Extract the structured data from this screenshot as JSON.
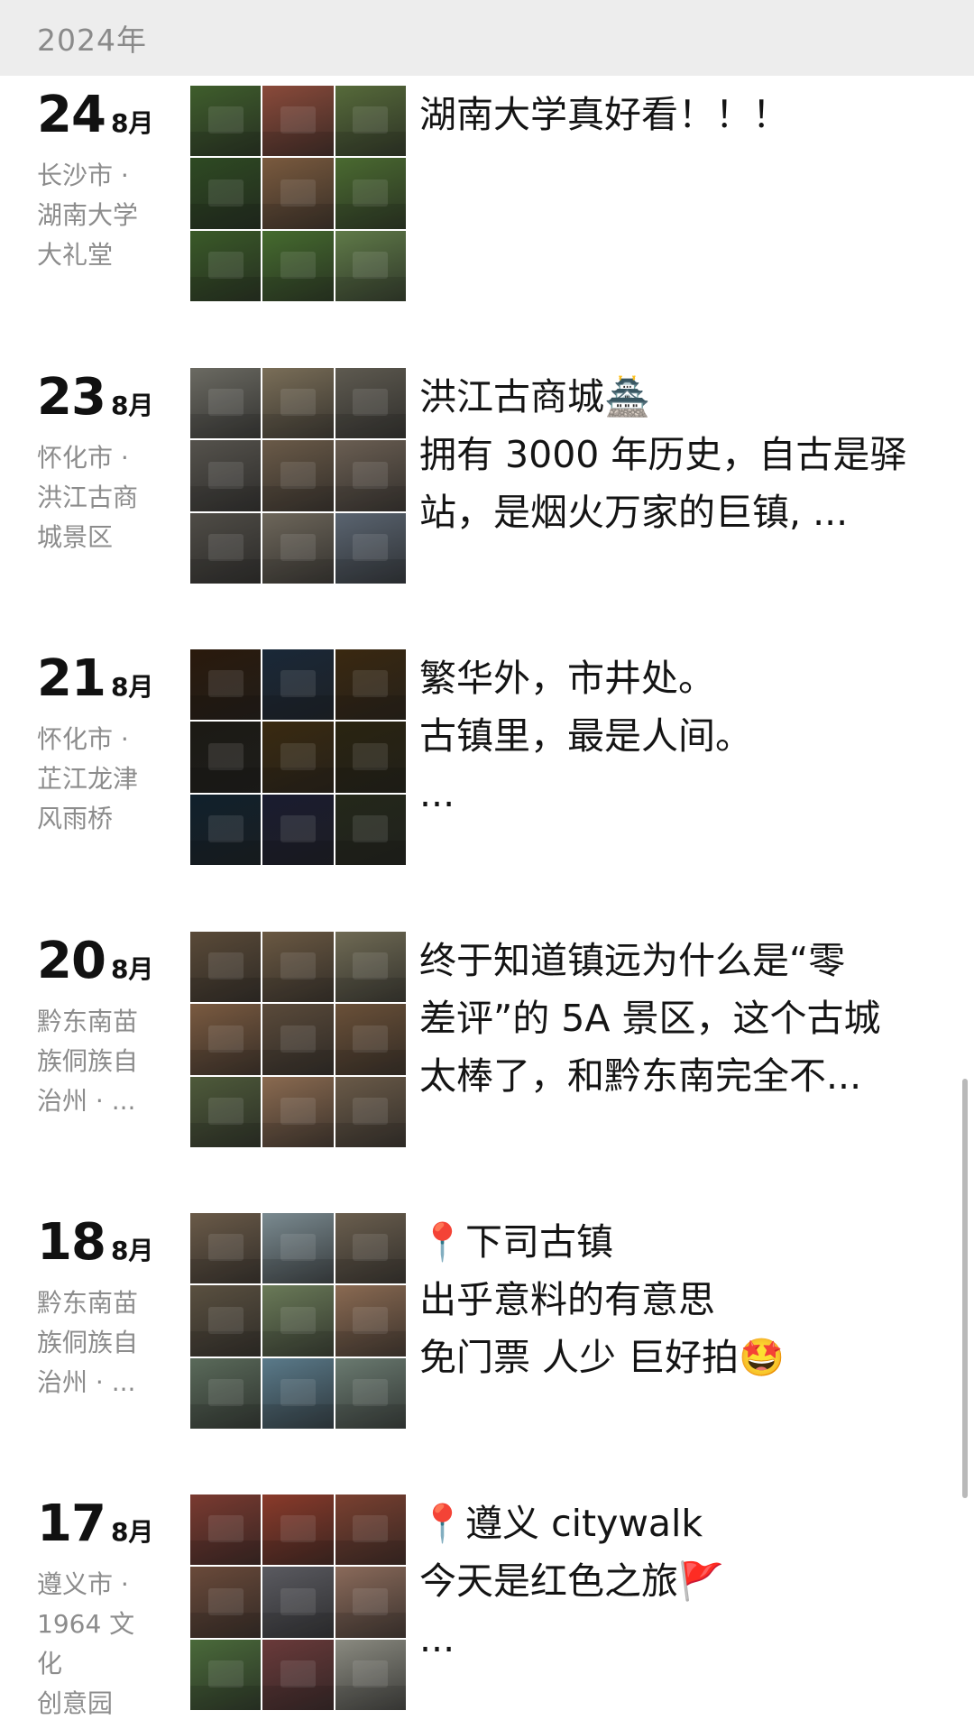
{
  "header": {
    "year": "2024年"
  },
  "entries": [
    {
      "day": "24",
      "month": "8月",
      "location": "长沙市 ·\n湖南大学\n大礼堂",
      "lines": [
        "湖南大学真好看！！！"
      ],
      "colors": [
        "#3f5e2c",
        "#8a4a3a",
        "#566a3a",
        "#2e4a22",
        "#7a5a3e",
        "#4a6a30",
        "#3a5a28",
        "#456b2e",
        "#5f7a48"
      ]
    },
    {
      "day": "23",
      "month": "8月",
      "location": "怀化市 ·\n洪江古商\n城景区",
      "lines": [
        "洪江古商城🏯",
        "拥有 3000 年历史，自古是驿",
        "站，是烟火万家的巨镇, ..."
      ],
      "colors": [
        "#6b6a62",
        "#7a6e58",
        "#5e5a50",
        "#55524c",
        "#6a5a48",
        "#6a5e52",
        "#4f4c46",
        "#6d665a",
        "#5a6470"
      ]
    },
    {
      "day": "21",
      "month": "8月",
      "location": "怀化市 ·\n芷江龙津\n风雨桥",
      "lines": [
        "繁华外，市井处。",
        "古镇里，最是人间。",
        "..."
      ],
      "colors": [
        "#2a1a0c",
        "#1a2838",
        "#3a2810",
        "#1c1a14",
        "#3a2a10",
        "#2a2410",
        "#10202c",
        "#1a1c30",
        "#24281a"
      ]
    },
    {
      "day": "20",
      "month": "8月",
      "location": "黔东南苗\n族侗族自\n治州 · ...",
      "lines": [
        "终于知道镇远为什么是“零",
        "差评”的 5A 景区，这个古城",
        "太棒了，和黔东南完全不..."
      ],
      "colors": [
        "#5a4a38",
        "#6a5842",
        "#6f6a54",
        "#7a5a40",
        "#5a4a3a",
        "#6a5038",
        "#4e5a3a",
        "#8a6a50",
        "#6a5a48"
      ]
    },
    {
      "day": "18",
      "month": "8月",
      "location": "黔东南苗\n族侗族自\n治州 · ...",
      "lines": [
        "📍下司古镇",
        "出乎意料的有意思",
        "免门票 人少 巨好拍🤩"
      ],
      "colors": [
        "#6a5a48",
        "#7a8a90",
        "#6a5e4e",
        "#5a5040",
        "#6a7a58",
        "#8a6a52",
        "#5a6a5a",
        "#5a7a8a",
        "#6a7a70"
      ]
    },
    {
      "day": "17",
      "month": "8月",
      "location": "遵义市 ·\n1964 文化\n创意园",
      "lines": [
        "📍遵义 citywalk",
        "今天是红色之旅🚩",
        "..."
      ],
      "colors": [
        "#7a3a30",
        "#8a3a2a",
        "#7a4030",
        "#6a4a3a",
        "#5a5a60",
        "#8a6a5a",
        "#4a6a3a",
        "#6a3a3a",
        "#8a8a80"
      ]
    }
  ]
}
